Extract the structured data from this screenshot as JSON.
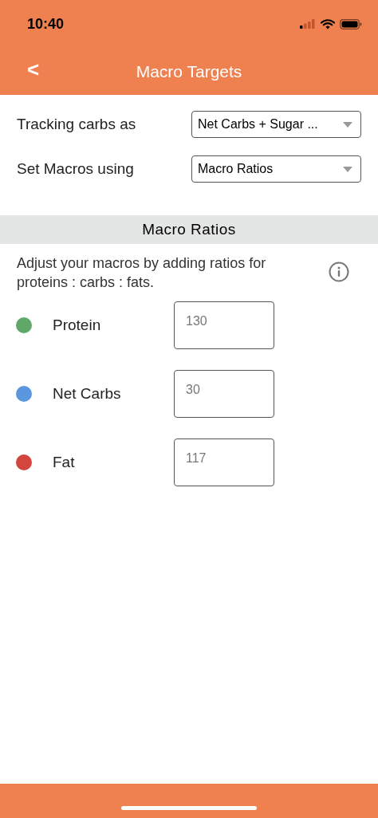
{
  "status_bar": {
    "time": "10:40"
  },
  "header": {
    "back": "<",
    "title": "Macro Targets"
  },
  "settings": [
    {
      "label": "Tracking carbs as",
      "value": "Net Carbs + Sugar ..."
    },
    {
      "label": "Set Macros using",
      "value": "Macro Ratios"
    }
  ],
  "section": {
    "title": "Macro Ratios",
    "description": "Adjust your macros by adding ratios for proteins : carbs : fats."
  },
  "macros": [
    {
      "name": "Protein",
      "color": "#5fa86a",
      "placeholder": "130"
    },
    {
      "name": "Net Carbs",
      "color": "#5b97de",
      "placeholder": "30"
    },
    {
      "name": "Fat",
      "color": "#d2463f",
      "placeholder": "117"
    }
  ]
}
